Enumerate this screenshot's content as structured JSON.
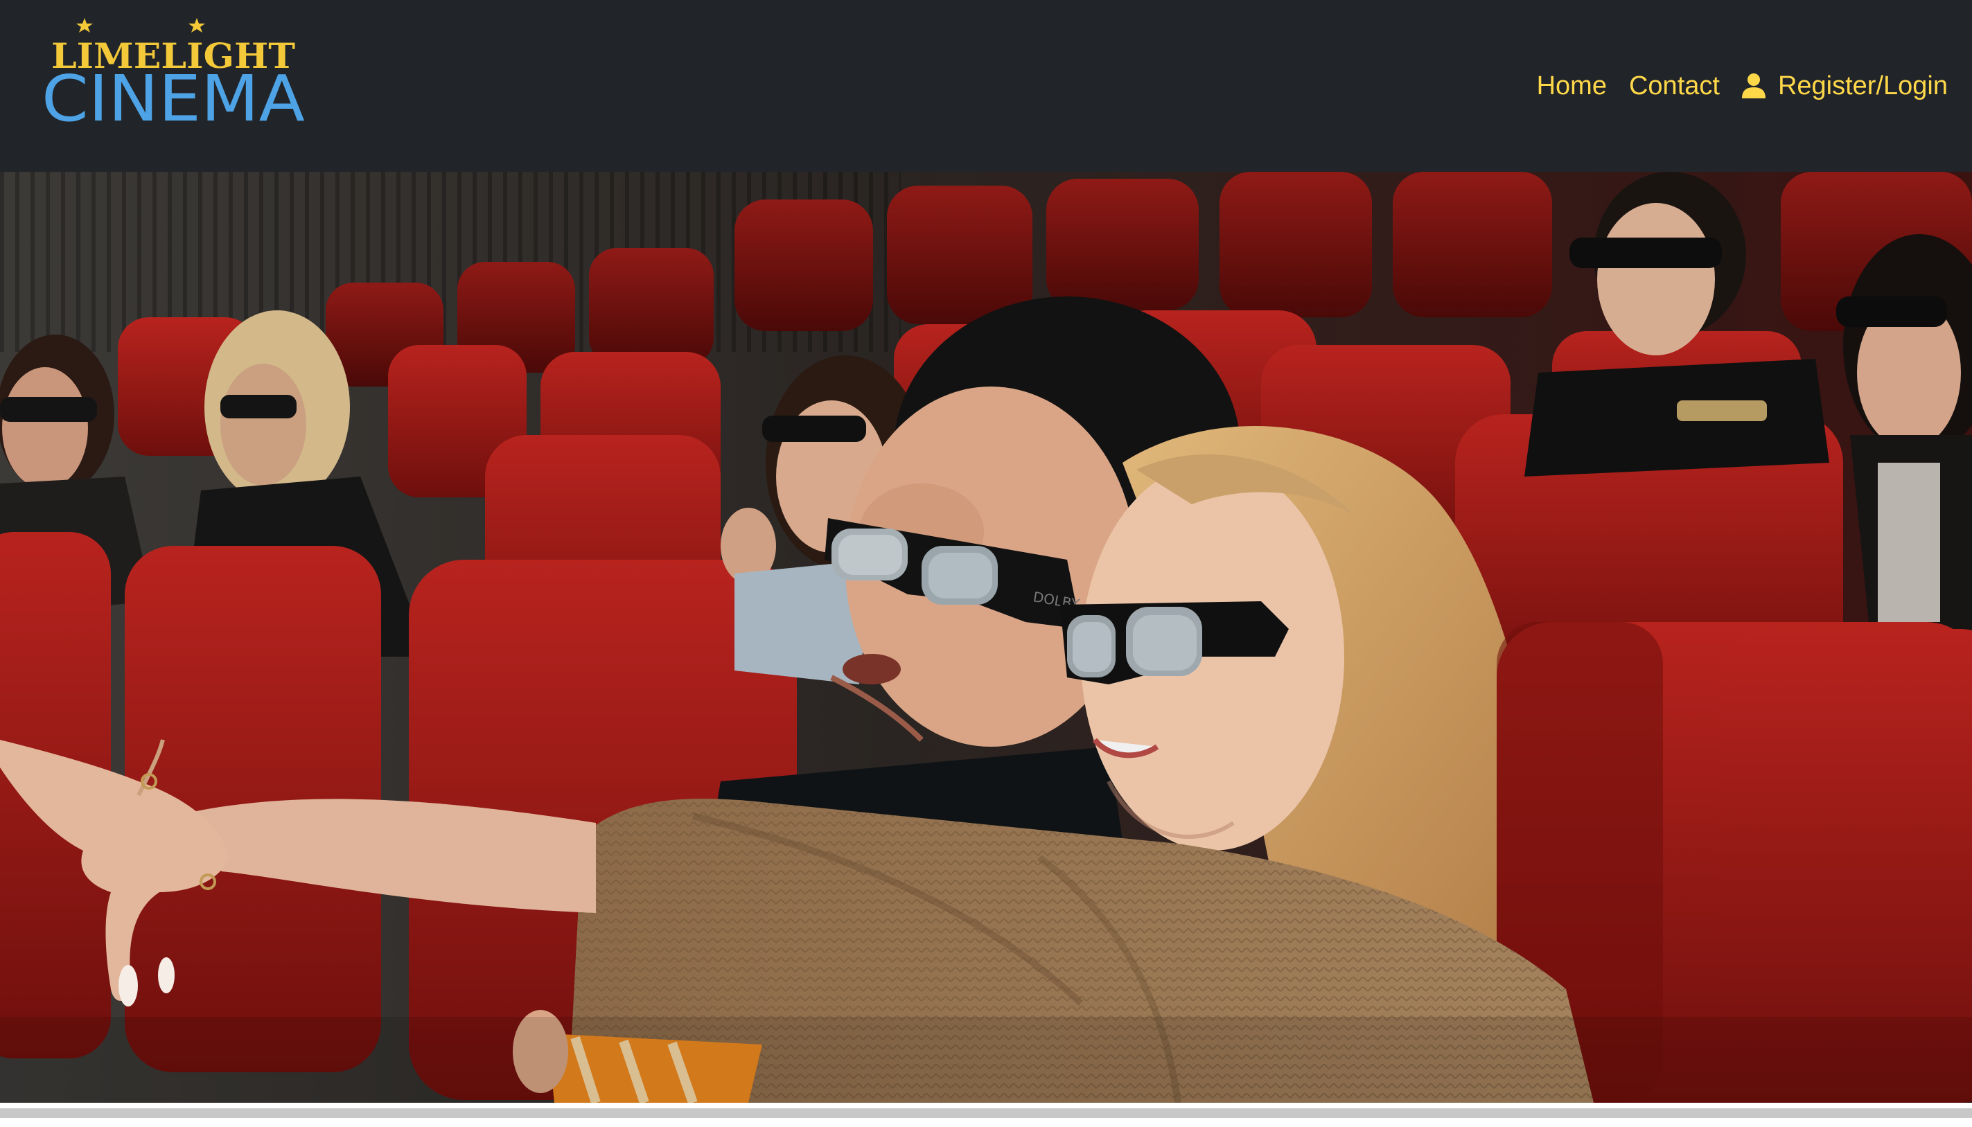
{
  "brand": {
    "line1": "LIMELIGHT",
    "line2": "CINEMA",
    "line1_color": "#f3c93a",
    "line2_color": "#4da3e6"
  },
  "nav": {
    "home": "Home",
    "contact": "Contact",
    "login": "Register/Login",
    "link_color": "#ffd84a",
    "login_icon": "user-icon"
  },
  "hero": {
    "image_description_icon": "cinema-audience-3d-glasses-image"
  },
  "colors": {
    "navbar_bg": "#212529",
    "seat_red": "#a31b18"
  }
}
